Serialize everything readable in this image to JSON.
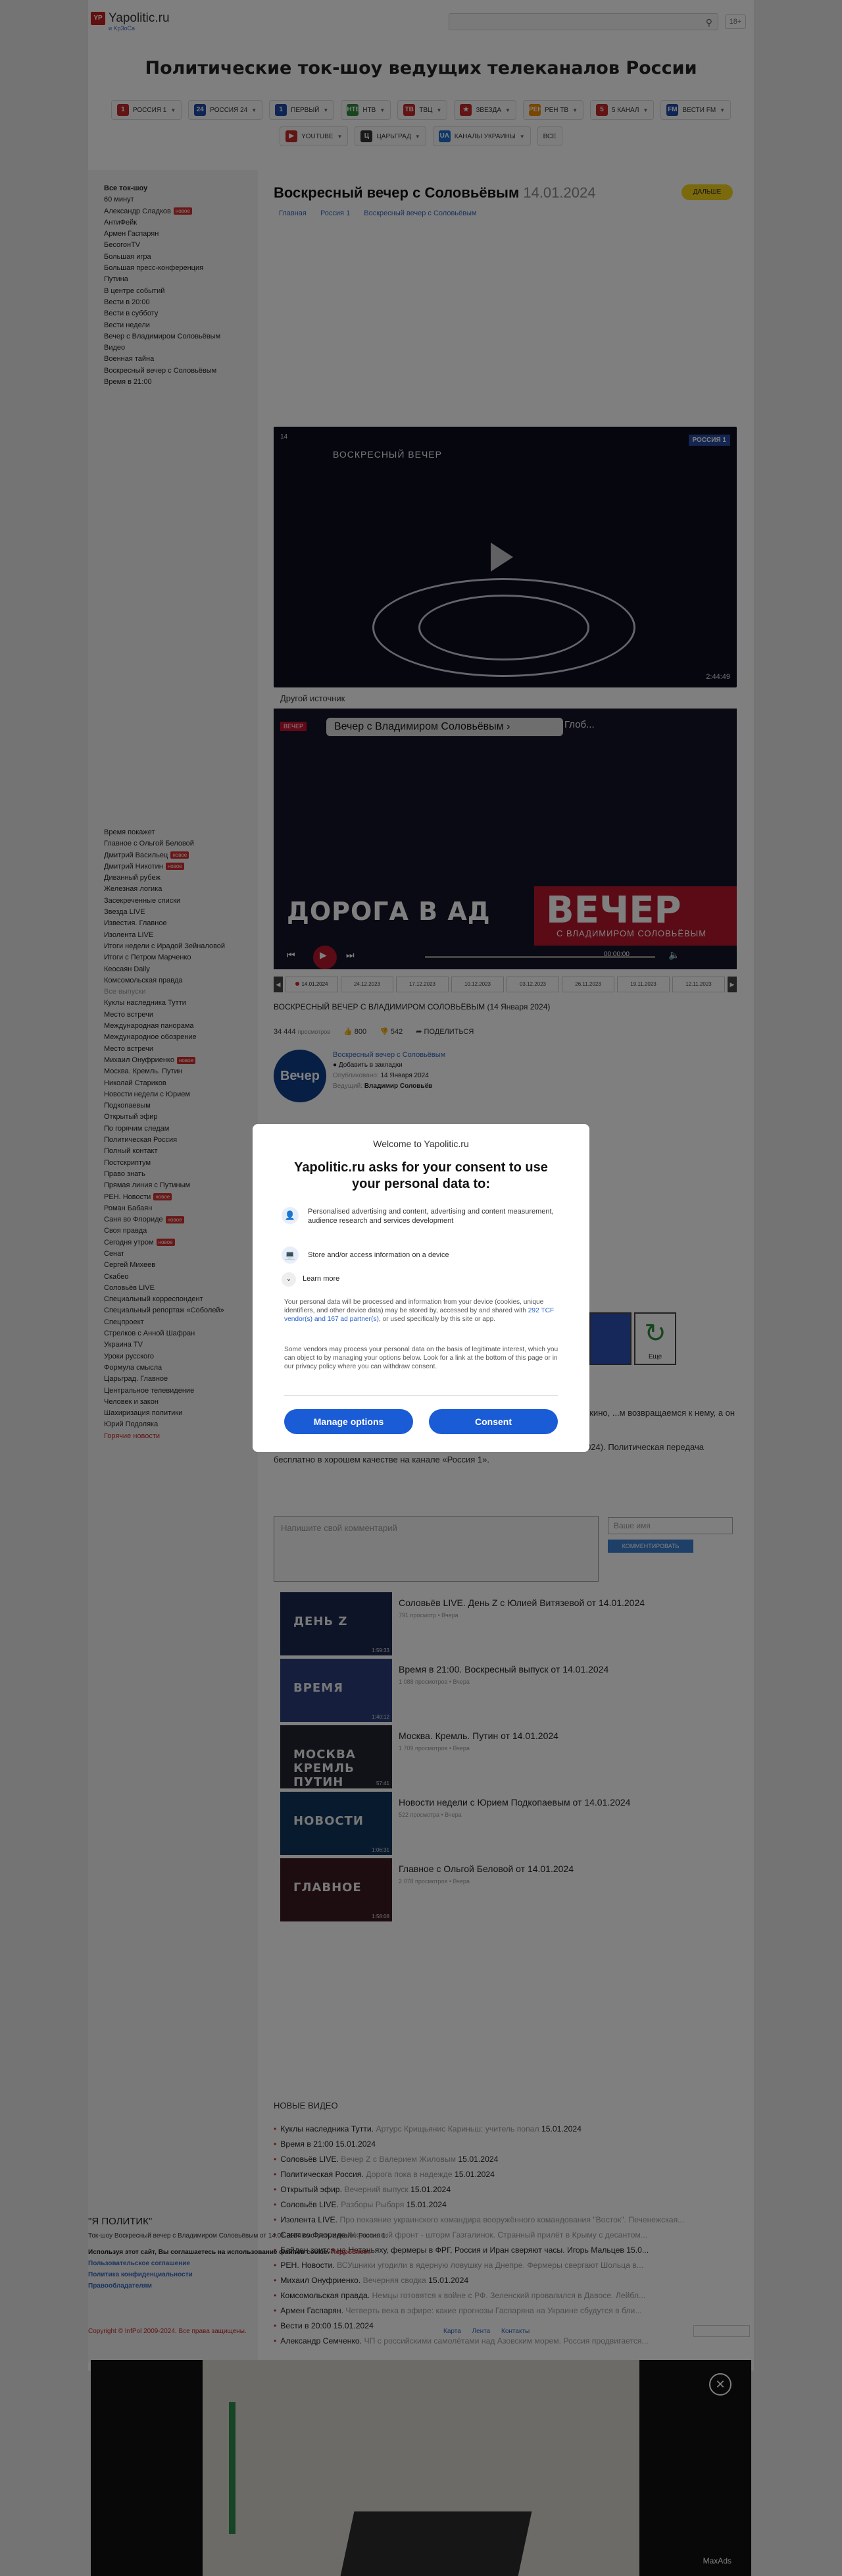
{
  "header": {
    "logo_badge": "YP",
    "logo_text": "Yapolitic.ru",
    "logo_sub": "и Kp3oCa",
    "age": "18+",
    "search_icon": "search-icon"
  },
  "page_heading": "Политические ток-шоу ведущих телеканалов России",
  "channels": [
    {
      "label": "РОССИЯ 1",
      "badge": "1",
      "color": "#c62828"
    },
    {
      "label": "РОССИЯ 24",
      "badge": "24",
      "color": "#1f4aa8"
    },
    {
      "label": "ПЕРВЫЙ",
      "badge": "1",
      "color": "#1f4aa8"
    },
    {
      "label": "НТВ",
      "badge": "НТВ",
      "color": "#2e8b3b"
    },
    {
      "label": "ТВЦ",
      "badge": "ТВ",
      "color": "#c62828"
    },
    {
      "label": "ЗВЕЗДА",
      "badge": "★",
      "color": "#c62828"
    },
    {
      "label": "РЕН ТВ",
      "badge": "РЕН",
      "color": "#f08c00"
    },
    {
      "label": "5 КАНАЛ",
      "badge": "5",
      "color": "#c62828"
    },
    {
      "label": "ВЕСТИ FM",
      "badge": "FM",
      "color": "#1f4aa8"
    },
    {
      "label": "YOUTUBE",
      "badge": "▶",
      "color": "#c62828"
    },
    {
      "label": "ЦАРЬГРАД",
      "badge": "Ц",
      "color": "#333333"
    },
    {
      "label": "КАНАЛЫ УКРАИНЫ",
      "badge": "UA",
      "color": "#1f6fd1"
    },
    {
      "label": "ВСЕ",
      "badge": "",
      "color": ""
    }
  ],
  "sidebar": {
    "heading": "Все ток-шоу",
    "items": [
      {
        "label": "60 минут",
        "new": ""
      },
      {
        "label": "Александр Сладков",
        "new": "новое"
      },
      {
        "label": "АнтиФейк",
        "new": ""
      },
      {
        "label": "Армен Гаспарян",
        "new": ""
      },
      {
        "label": "БесогонTV",
        "new": ""
      },
      {
        "label": "Большая игра",
        "new": ""
      },
      {
        "label": "Большая пресс-конференция",
        "new": ""
      },
      {
        "label": "Путина",
        "new": ""
      },
      {
        "label": "В центре событий",
        "new": ""
      },
      {
        "label": "Вести в 20:00",
        "new": ""
      },
      {
        "label": "Вести в субботу",
        "new": ""
      },
      {
        "label": "Вести недели",
        "new": ""
      },
      {
        "label": "Вечер с Владимиром Соловьёвым",
        "new": ""
      },
      {
        "label": "Видео",
        "new": ""
      },
      {
        "label": "Военная тайна",
        "new": ""
      },
      {
        "label": "Воскресный вечер с Соловьёвым",
        "new": ""
      },
      {
        "label": "Время в 21:00",
        "new": ""
      }
    ],
    "items2": [
      {
        "label": "Время покажет",
        "new": "",
        "style": ""
      },
      {
        "label": "Главное с Ольгой Беловой",
        "new": "",
        "style": ""
      },
      {
        "label": "Дмитрий Васильец",
        "new": "новое",
        "style": ""
      },
      {
        "label": "Дмитрий Никотин",
        "new": "новое",
        "style": ""
      },
      {
        "label": "Диванный рубеж",
        "new": "",
        "style": ""
      },
      {
        "label": "Железная логика",
        "new": "",
        "style": ""
      },
      {
        "label": "Засекреченные списки",
        "new": "",
        "style": ""
      },
      {
        "label": "Звезда LIVE",
        "new": "",
        "style": ""
      },
      {
        "label": "Известия. Главное",
        "new": "",
        "style": ""
      },
      {
        "label": "Изолента LIVE",
        "new": "",
        "style": ""
      },
      {
        "label": "Итоги недели с Ирадой Зейналовой",
        "new": "",
        "style": ""
      },
      {
        "label": "Итоги с Петром Марченко",
        "new": "",
        "style": ""
      },
      {
        "label": "Кеосаян Daily",
        "new": "",
        "style": ""
      },
      {
        "label": "Комсомольская правда",
        "new": "",
        "style": ""
      },
      {
        "label": "Все выпуски",
        "new": "",
        "style": "grey"
      },
      {
        "label": "Куклы наследника Тутти",
        "new": "",
        "style": ""
      },
      {
        "label": "Место встречи",
        "new": "",
        "style": ""
      },
      {
        "label": "Международная панорама",
        "new": "",
        "style": ""
      },
      {
        "label": "Международное обозрение",
        "new": "",
        "style": ""
      },
      {
        "label": "Место встречи",
        "new": "",
        "style": ""
      },
      {
        "label": "Михаил Онуфриенко",
        "new": "новое",
        "style": ""
      },
      {
        "label": "Москва. Кремль. Путин",
        "new": "",
        "style": ""
      },
      {
        "label": "Николай Стариков",
        "new": "",
        "style": ""
      },
      {
        "label": "Новости недели с Юрием",
        "new": "",
        "style": ""
      },
      {
        "label": "Подкопаевым",
        "new": "",
        "style": ""
      },
      {
        "label": "Открытый эфир",
        "new": "",
        "style": ""
      },
      {
        "label": "По горячим следам",
        "new": "",
        "style": ""
      },
      {
        "label": "Политическая Россия",
        "new": "",
        "style": ""
      },
      {
        "label": "Полный контакт",
        "new": "",
        "style": ""
      },
      {
        "label": "Постскриптум",
        "new": "",
        "style": ""
      },
      {
        "label": "Право знать",
        "new": "",
        "style": ""
      },
      {
        "label": "Прямая линия с Путиным",
        "new": "",
        "style": ""
      },
      {
        "label": "РЕН. Новости",
        "new": "новое",
        "style": ""
      },
      {
        "label": "Роман Бабаян",
        "new": "",
        "style": ""
      },
      {
        "label": "Саня во Флориде",
        "new": "новое",
        "style": ""
      },
      {
        "label": "Своя правда",
        "new": "",
        "style": ""
      },
      {
        "label": "Сегодня утром",
        "new": "новое",
        "style": ""
      },
      {
        "label": "Сенат",
        "new": "",
        "style": ""
      },
      {
        "label": "Сергей Михеев",
        "new": "",
        "style": ""
      },
      {
        "label": "Скабео",
        "new": "",
        "style": ""
      },
      {
        "label": "Соловьёв LIVE",
        "new": "",
        "style": ""
      },
      {
        "label": "Специальный корреспондент",
        "new": "",
        "style": ""
      },
      {
        "label": "Специальный репортаж «Соболей»",
        "new": "",
        "style": ""
      },
      {
        "label": "Спецпроект",
        "new": "",
        "style": ""
      },
      {
        "label": "Стрелков с Анной Шафран",
        "new": "",
        "style": ""
      },
      {
        "label": "Украина TV",
        "new": "",
        "style": ""
      },
      {
        "label": "Уроки русского",
        "new": "",
        "style": ""
      },
      {
        "label": "Формула смысла",
        "new": "",
        "style": ""
      },
      {
        "label": "Царьград. Главное",
        "new": "",
        "style": ""
      },
      {
        "label": "Центральное телевидение",
        "new": "",
        "style": ""
      },
      {
        "label": "Человек и закон",
        "new": "",
        "style": ""
      },
      {
        "label": "Шахиризация политики",
        "new": "",
        "style": ""
      },
      {
        "label": "Юрий Подоляка",
        "new": "",
        "style": ""
      },
      {
        "label": "Горячие новости",
        "new": "",
        "style": "red"
      }
    ]
  },
  "episode": {
    "title": "Воскресный вечер с Соловьёвым",
    "date": "14.01.2024",
    "further_button": "ДАЛЬШЕ",
    "crumbs": [
      "Главная",
      "Россия 1",
      "Воскресный вечер с Соловьёвым"
    ],
    "video1_badge": "14",
    "video1_caption": "ВОСКРЕСНЫЙ ВЕЧЕР",
    "video1_channel": "РОССИЯ 1",
    "video1_duration": "2:44:49",
    "other_source": "Другой источник",
    "video2_top": "Вечер с Владимиром Соловьёвым ›",
    "video2_top_extra": "Глоб...",
    "video2_tag": "ВЕЧЕР",
    "video2_road": "ДОРОГА В АД",
    "video2_vecher": "ВЕЧЕР",
    "video2_sub": "С ВЛАДИМИРОМ СОЛОВЬЁВЫМ",
    "video2_time": "00:00:00",
    "date_nav": [
      "14.01.2024",
      "24.12.2023",
      "17.12.2023",
      "10.12.2023",
      "03.12.2023",
      "26.11.2023",
      "19.11.2023",
      "12.11.2023"
    ],
    "episode_line": "ВОСКРЕСНЫЙ ВЕЧЕР С ВЛАДИМИРОМ СОЛОВЬЁВЫМ (14 Января 2024)",
    "views": "34 444",
    "views_label": "просмотров",
    "likes": "800",
    "dislikes": "542",
    "share": "ПОДЕЛИТЬСЯ",
    "channel_logo": "Вечер",
    "channel_name": "Воскресный вечер с Соловьёвым",
    "bookmark": "Добавить в закладки",
    "published_label": "Опубликовано:",
    "published": "14 Января 2024",
    "host_label": "Ведущий:",
    "host": "Владимир Соловьёв",
    "thumb_green_label": "Еще",
    "desc1": "...брый. Смотря с чем ...в регулярные встречи. За это ...сподину показу как раз кино, ...м возвращаемся к нему, а он уже не командир корпуса, а командующий армии.",
    "desc2": "Смотрите онлайн Воскресный вечер с Владимиром Соловьёвым (14 Января 2024). Политическая передача бесплатно в хорошем качестве на канале «Россия 1».",
    "comment_placeholder": "Напишите свой комментарий",
    "name_placeholder": "Ваше имя",
    "send_button": "КОММЕНТИРОВАТЬ"
  },
  "related": [
    {
      "title": "Соловьёв LIVE. День Z с Юлией Витязевой от 14.01.2024",
      "meta": "791 просмотр • Вчера",
      "thumb": "ДЕНЬ Z",
      "duration": "1:59:33"
    },
    {
      "title": "Время в 21:00. Воскресный выпуск от 14.01.2024",
      "meta": "1 088 просмотров • Вчера",
      "thumb": "ВРЕМЯ",
      "duration": "1:40:12"
    },
    {
      "title": "Москва. Кремль. Путин от 14.01.2024",
      "meta": "1 709 просмотров • Вчера",
      "thumb": "МОСКВА КРЕМЛЬ ПУТИН",
      "duration": "57:41"
    },
    {
      "title": "Новости недели с Юрием Подкопаевым от 14.01.2024",
      "meta": "522 просмотра • Вчера",
      "thumb": "НОВОСТИ",
      "duration": "1:06:31"
    },
    {
      "title": "Главное с Ольгой Беловой от 14.01.2024",
      "meta": "2 078 просмотров • Вчера",
      "thumb": "ГЛАВНОЕ",
      "duration": "1:58:08"
    }
  ],
  "new_videos": {
    "heading": "НОВЫЕ ВИДЕО",
    "items": [
      {
        "show": "Куклы наследника Тутти.",
        "desc": "Артурс Крищьянис Кариньш: учитель попал",
        "date": "15.01.2024"
      },
      {
        "show": "Время в 21:00",
        "desc": "",
        "date": "15.01.2024"
      },
      {
        "show": "Соловьёв LIVE.",
        "desc": "Вечер Z с Валерием Жиловым",
        "date": "15.01.2024"
      },
      {
        "show": "Политическая Россия.",
        "desc": "Дорога пока в надежде",
        "date": "15.01.2024"
      },
      {
        "show": "Открытый эфир.",
        "desc": "Вечерний выпуск",
        "date": "15.01.2024"
      },
      {
        "show": "Соловьёв LIVE.",
        "desc": "Разборы Рыбаря",
        "date": "15.01.2024"
      },
      {
        "show": "Изолента LIVE.",
        "desc": "Про покаяние украинского командира вооружённого командования \"Восток\". Печенежская...",
        "date": ""
      },
      {
        "show": "Саня во Флориде.",
        "desc": "Украинский фронт - шторм Газгалинок. Странный прилёт в Крыму с десантом...",
        "date": ""
      },
      {
        "show": "Байден зоится на Нетаньяху, фермеры в ФРГ, Россия и Иран сверяют часы. Игорь Мальцев 15.0...",
        "desc": "",
        "date": ""
      },
      {
        "show": "РЕН. Новости.",
        "desc": "ВСУшники угодили в ядерную ловушку на Днепре. Фермеры свергают Шольца в...",
        "date": ""
      },
      {
        "show": "Михаил Онуфриенко.",
        "desc": "Вечерняя сводка",
        "date": "15.01.2024"
      },
      {
        "show": "Комсомольская правда.",
        "desc": "Немцы готовятся к войне с РФ. Зеленский провалился в Давосе. Лейбл...",
        "date": ""
      },
      {
        "show": "Армен Гаспарян.",
        "desc": "Четверть века в эфире: какие прогнозы Гаспаряна на Украине сбудутся в бли...",
        "date": ""
      },
      {
        "show": "Вести в 20:00",
        "desc": "",
        "date": "15.01.2024"
      },
      {
        "show": "Александр Семченко.",
        "desc": "ЧП с российскими самолётами над Азовским морем. Россия продвигается...",
        "date": ""
      }
    ]
  },
  "footer": {
    "brand": "\"Я ПОЛИТИК\"",
    "line": "Ток-шоу Воскресный вечер с Владимиром Соловьёвым от 14.01.2024 смотреть онлайн. Россия 1.",
    "cookie": "Используя этот сайт, Вы соглашаетесь на использование файлов cookie.",
    "cookie_more": "Подробнее»",
    "links": [
      "Пользовательское соглашение",
      "Политика конфиденциальности",
      "Правообладателям"
    ],
    "copyright": "Copyright © InfPol 2009-2024. Все права защищены.",
    "right_links": [
      "Карта",
      "Лента",
      "Контакты"
    ]
  },
  "consent": {
    "welcome": "Welcome to Yapolitic.ru",
    "title": "Yapolitic.ru asks for your consent to use your personal data to:",
    "purpose1": "Personalised advertising and content, advertising and content measurement, audience research and services development",
    "purpose2": "Store and/or access information on a device",
    "learn_more": "Learn more",
    "p1a": "Your personal data will be processed and information from your device (cookies, unique identifiers, and other device data) may be stored by, accessed by and shared with",
    "p1link": "292 TCF vendor(s) and 167 ad partner(s)",
    "p1b": ", or used specifically by this site or app.",
    "p2": "Some vendors may process your personal data on the basis of legitimate interest, which you can object to by managing your options below. Look for a link at the bottom of this page or in our privacy policy where you can withdraw consent.",
    "manage": "Manage options",
    "consent_button": "Consent"
  },
  "ad": {
    "close": "✕",
    "brand": "MaxAds"
  }
}
